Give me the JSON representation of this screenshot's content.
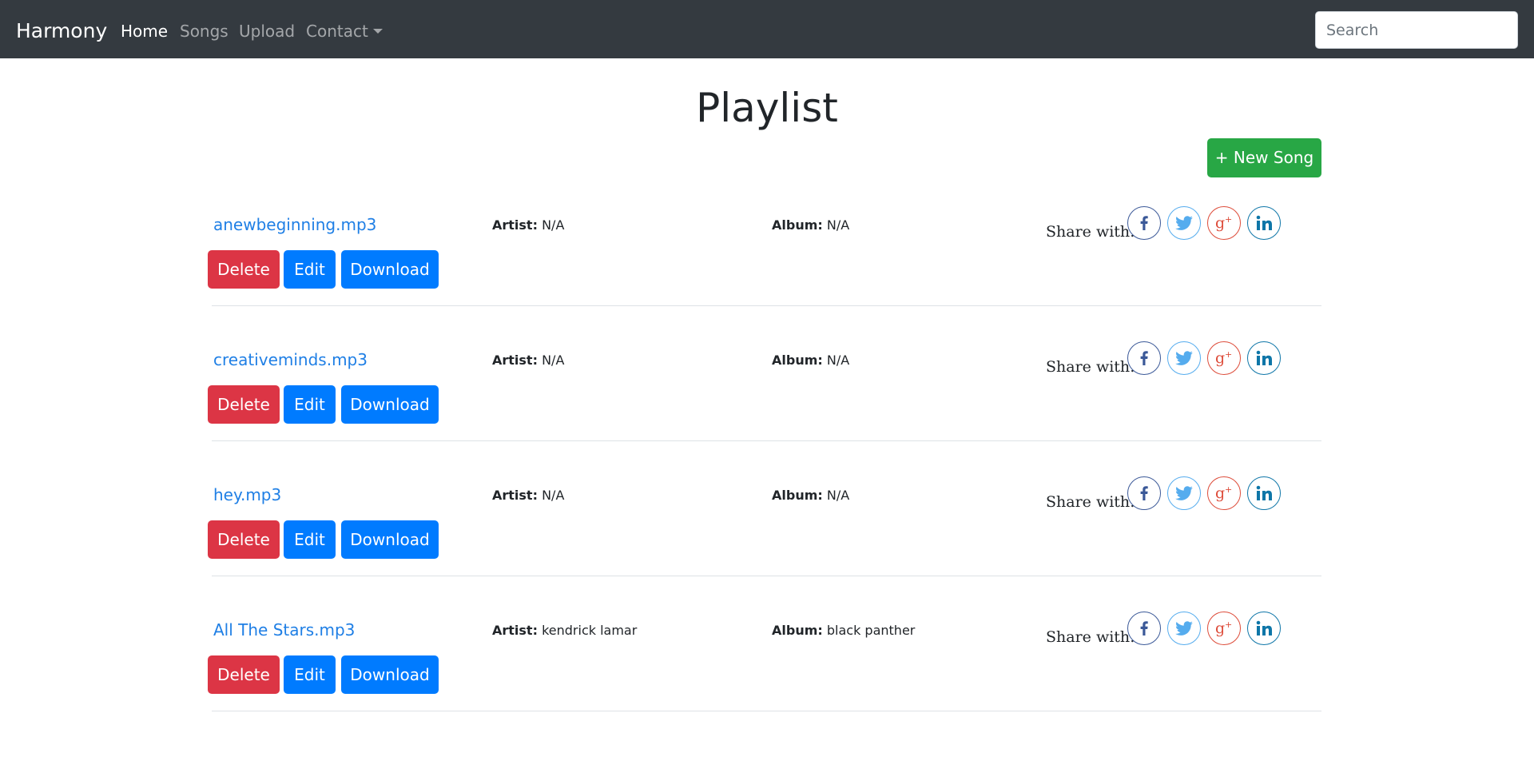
{
  "navbar": {
    "brand": "Harmony",
    "links": [
      {
        "label": "Home",
        "active": true
      },
      {
        "label": "Songs",
        "active": false
      },
      {
        "label": "Upload",
        "active": false
      },
      {
        "label": "Contact",
        "active": false,
        "dropdown": true
      }
    ],
    "search_placeholder": "Search"
  },
  "page": {
    "title": "Playlist",
    "new_song_label": "+ New Song"
  },
  "labels": {
    "artist": "Artist:",
    "album": "Album:",
    "share": "Share with:",
    "delete": "Delete",
    "edit": "Edit",
    "download": "Download"
  },
  "share_icons": [
    "facebook-icon",
    "twitter-icon",
    "google-plus-icon",
    "linkedin-icon"
  ],
  "colors": {
    "navbar_bg": "#343a40",
    "success": "#28a745",
    "danger": "#dc3545",
    "primary": "#007bff",
    "link": "#1f7fe5",
    "facebook": "#3b5998",
    "twitter": "#55acee",
    "google_plus": "#dd4b39",
    "linkedin": "#0e76a8"
  },
  "songs": [
    {
      "title": "anewbeginning.mp3",
      "artist": "N/A",
      "album": "N/A"
    },
    {
      "title": "creativeminds.mp3",
      "artist": "N/A",
      "album": "N/A"
    },
    {
      "title": "hey.mp3",
      "artist": "N/A",
      "album": "N/A"
    },
    {
      "title": "All The Stars.mp3",
      "artist": "kendrick lamar",
      "album": "black panther"
    }
  ]
}
